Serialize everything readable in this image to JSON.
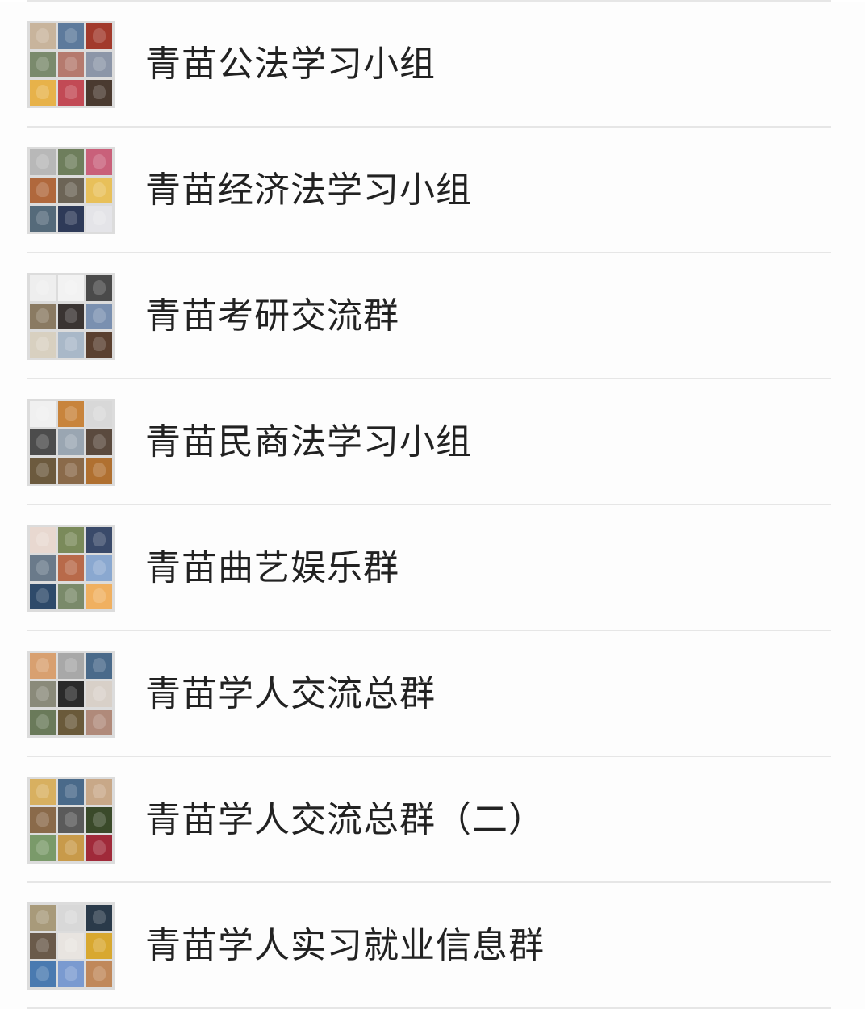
{
  "groups": [
    {
      "name": "青苗公法学习小组",
      "avatar_icon": "group-collage-avatar",
      "tile_colors": [
        "#c8b49c",
        "#5d7a9c",
        "#a23a2c",
        "#7a8a6c",
        "#b57a6e",
        "#8c96a8",
        "#e7b24a",
        "#c24a55",
        "#4a3a30"
      ]
    },
    {
      "name": "青苗经济法学习小组",
      "avatar_icon": "group-collage-avatar",
      "tile_colors": [
        "#b8b8b8",
        "#6e7e5c",
        "#c9607a",
        "#b0683c",
        "#6c6456",
        "#e8c05a",
        "#556a7a",
        "#2e3a58",
        "#e4e4e8"
      ]
    },
    {
      "name": "青苗考研交流群",
      "avatar_icon": "group-collage-avatar",
      "tile_colors": [
        "#eeeeee",
        "#f2f2f2",
        "#4a4a4a",
        "#8a7a62",
        "#3a3432",
        "#7a90b0",
        "#d8d0c0",
        "#a9b8c8",
        "#5a4030"
      ]
    },
    {
      "name": "青苗民商法学习小组",
      "avatar_icon": "group-collage-avatar",
      "tile_colors": [
        "#f0f0f0",
        "#c8843c",
        "#d8d8d8",
        "#4c4c4c",
        "#9aa6b2",
        "#5a4a3e",
        "#6c5a3e",
        "#8a6a4a",
        "#b07030"
      ]
    },
    {
      "name": "青苗曲艺娱乐群",
      "avatar_icon": "group-collage-avatar",
      "tile_colors": [
        "#e8d8d0",
        "#7a8a5a",
        "#3a4a6a",
        "#6a7a8a",
        "#b86a4a",
        "#8aa8d0",
        "#2e4a6a",
        "#7a8a6a",
        "#f0b060"
      ]
    },
    {
      "name": "青苗学人交流总群",
      "avatar_icon": "group-collage-avatar",
      "tile_colors": [
        "#d8a070",
        "#a8a8a8",
        "#4a6a8a",
        "#8a8a7a",
        "#2a2a2a",
        "#d8d0c8",
        "#6a7a5a",
        "#6a5a3a",
        "#b08a7a"
      ]
    },
    {
      "name": "青苗学人交流总群（二）",
      "avatar_icon": "group-collage-avatar",
      "tile_colors": [
        "#d8b060",
        "#4a6a8a",
        "#c8a888",
        "#8a6a4a",
        "#5a5a5a",
        "#3a4a2a",
        "#7a9a6a",
        "#c89a4a",
        "#a02a3a"
      ]
    },
    {
      "name": "青苗学人实习就业信息群",
      "avatar_icon": "group-collage-avatar",
      "tile_colors": [
        "#a89a7a",
        "#d8d8d8",
        "#2a3a4a",
        "#6a5a4a",
        "#e8e4e0",
        "#d8a830",
        "#4a7ab0",
        "#7a9ad0",
        "#c0885a"
      ]
    }
  ]
}
